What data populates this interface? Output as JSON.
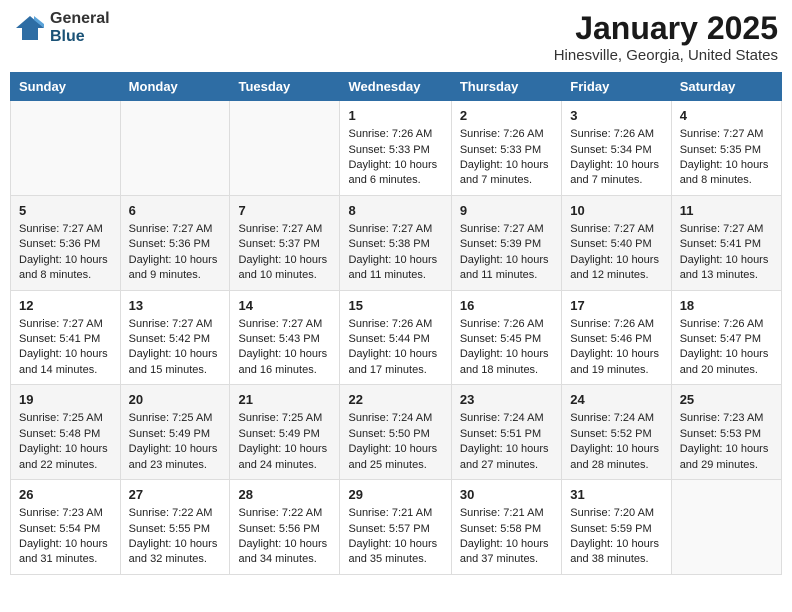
{
  "header": {
    "logo_general": "General",
    "logo_blue": "Blue",
    "title": "January 2025",
    "subtitle": "Hinesville, Georgia, United States"
  },
  "days_of_week": [
    "Sunday",
    "Monday",
    "Tuesday",
    "Wednesday",
    "Thursday",
    "Friday",
    "Saturday"
  ],
  "weeks": [
    [
      {
        "day": "",
        "info": ""
      },
      {
        "day": "",
        "info": ""
      },
      {
        "day": "",
        "info": ""
      },
      {
        "day": "1",
        "info": "Sunrise: 7:26 AM\nSunset: 5:33 PM\nDaylight: 10 hours\nand 6 minutes."
      },
      {
        "day": "2",
        "info": "Sunrise: 7:26 AM\nSunset: 5:33 PM\nDaylight: 10 hours\nand 7 minutes."
      },
      {
        "day": "3",
        "info": "Sunrise: 7:26 AM\nSunset: 5:34 PM\nDaylight: 10 hours\nand 7 minutes."
      },
      {
        "day": "4",
        "info": "Sunrise: 7:27 AM\nSunset: 5:35 PM\nDaylight: 10 hours\nand 8 minutes."
      }
    ],
    [
      {
        "day": "5",
        "info": "Sunrise: 7:27 AM\nSunset: 5:36 PM\nDaylight: 10 hours\nand 8 minutes."
      },
      {
        "day": "6",
        "info": "Sunrise: 7:27 AM\nSunset: 5:36 PM\nDaylight: 10 hours\nand 9 minutes."
      },
      {
        "day": "7",
        "info": "Sunrise: 7:27 AM\nSunset: 5:37 PM\nDaylight: 10 hours\nand 10 minutes."
      },
      {
        "day": "8",
        "info": "Sunrise: 7:27 AM\nSunset: 5:38 PM\nDaylight: 10 hours\nand 11 minutes."
      },
      {
        "day": "9",
        "info": "Sunrise: 7:27 AM\nSunset: 5:39 PM\nDaylight: 10 hours\nand 11 minutes."
      },
      {
        "day": "10",
        "info": "Sunrise: 7:27 AM\nSunset: 5:40 PM\nDaylight: 10 hours\nand 12 minutes."
      },
      {
        "day": "11",
        "info": "Sunrise: 7:27 AM\nSunset: 5:41 PM\nDaylight: 10 hours\nand 13 minutes."
      }
    ],
    [
      {
        "day": "12",
        "info": "Sunrise: 7:27 AM\nSunset: 5:41 PM\nDaylight: 10 hours\nand 14 minutes."
      },
      {
        "day": "13",
        "info": "Sunrise: 7:27 AM\nSunset: 5:42 PM\nDaylight: 10 hours\nand 15 minutes."
      },
      {
        "day": "14",
        "info": "Sunrise: 7:27 AM\nSunset: 5:43 PM\nDaylight: 10 hours\nand 16 minutes."
      },
      {
        "day": "15",
        "info": "Sunrise: 7:26 AM\nSunset: 5:44 PM\nDaylight: 10 hours\nand 17 minutes."
      },
      {
        "day": "16",
        "info": "Sunrise: 7:26 AM\nSunset: 5:45 PM\nDaylight: 10 hours\nand 18 minutes."
      },
      {
        "day": "17",
        "info": "Sunrise: 7:26 AM\nSunset: 5:46 PM\nDaylight: 10 hours\nand 19 minutes."
      },
      {
        "day": "18",
        "info": "Sunrise: 7:26 AM\nSunset: 5:47 PM\nDaylight: 10 hours\nand 20 minutes."
      }
    ],
    [
      {
        "day": "19",
        "info": "Sunrise: 7:25 AM\nSunset: 5:48 PM\nDaylight: 10 hours\nand 22 minutes."
      },
      {
        "day": "20",
        "info": "Sunrise: 7:25 AM\nSunset: 5:49 PM\nDaylight: 10 hours\nand 23 minutes."
      },
      {
        "day": "21",
        "info": "Sunrise: 7:25 AM\nSunset: 5:49 PM\nDaylight: 10 hours\nand 24 minutes."
      },
      {
        "day": "22",
        "info": "Sunrise: 7:24 AM\nSunset: 5:50 PM\nDaylight: 10 hours\nand 25 minutes."
      },
      {
        "day": "23",
        "info": "Sunrise: 7:24 AM\nSunset: 5:51 PM\nDaylight: 10 hours\nand 27 minutes."
      },
      {
        "day": "24",
        "info": "Sunrise: 7:24 AM\nSunset: 5:52 PM\nDaylight: 10 hours\nand 28 minutes."
      },
      {
        "day": "25",
        "info": "Sunrise: 7:23 AM\nSunset: 5:53 PM\nDaylight: 10 hours\nand 29 minutes."
      }
    ],
    [
      {
        "day": "26",
        "info": "Sunrise: 7:23 AM\nSunset: 5:54 PM\nDaylight: 10 hours\nand 31 minutes."
      },
      {
        "day": "27",
        "info": "Sunrise: 7:22 AM\nSunset: 5:55 PM\nDaylight: 10 hours\nand 32 minutes."
      },
      {
        "day": "28",
        "info": "Sunrise: 7:22 AM\nSunset: 5:56 PM\nDaylight: 10 hours\nand 34 minutes."
      },
      {
        "day": "29",
        "info": "Sunrise: 7:21 AM\nSunset: 5:57 PM\nDaylight: 10 hours\nand 35 minutes."
      },
      {
        "day": "30",
        "info": "Sunrise: 7:21 AM\nSunset: 5:58 PM\nDaylight: 10 hours\nand 37 minutes."
      },
      {
        "day": "31",
        "info": "Sunrise: 7:20 AM\nSunset: 5:59 PM\nDaylight: 10 hours\nand 38 minutes."
      },
      {
        "day": "",
        "info": ""
      }
    ]
  ]
}
